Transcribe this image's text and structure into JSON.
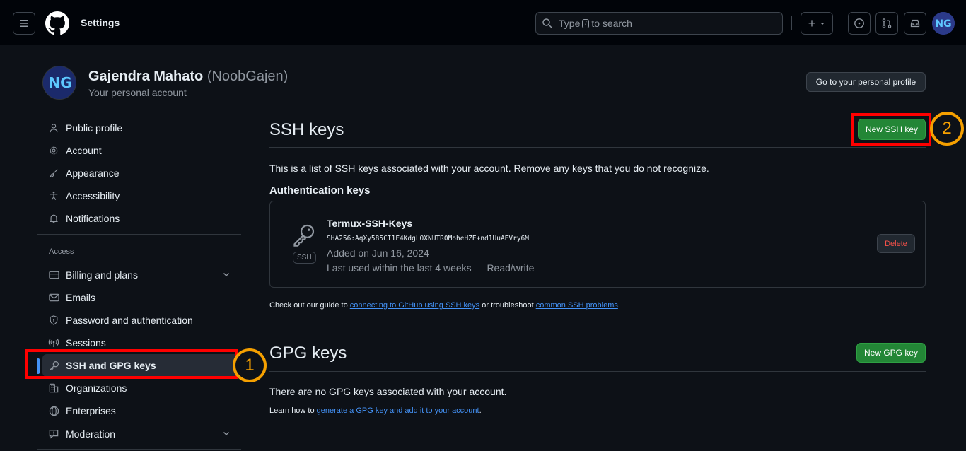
{
  "header": {
    "title": "Settings",
    "search_text_pre": "Type",
    "search_key": "/",
    "search_text_post": "to search",
    "plus_label": "+"
  },
  "profile": {
    "name": "Gajendra Mahato",
    "handle": "(NoobGajen)",
    "subtitle": "Your personal account",
    "avatar_text": "NG",
    "go_profile_button": "Go to your personal profile"
  },
  "sidebar": {
    "items_top": [
      {
        "label": "Public profile",
        "icon": "person-icon"
      },
      {
        "label": "Account",
        "icon": "gear-icon"
      },
      {
        "label": "Appearance",
        "icon": "paintbrush-icon"
      },
      {
        "label": "Accessibility",
        "icon": "accessibility-icon"
      },
      {
        "label": "Notifications",
        "icon": "bell-icon"
      }
    ],
    "access_heading": "Access",
    "items_access": [
      {
        "label": "Billing and plans",
        "icon": "credit-card-icon"
      },
      {
        "label": "Emails",
        "icon": "mail-icon"
      },
      {
        "label": "Password and authentication",
        "icon": "shield-lock-icon"
      },
      {
        "label": "Sessions",
        "icon": "broadcast-icon"
      },
      {
        "label": "SSH and GPG keys",
        "icon": "key-icon"
      },
      {
        "label": "Organizations",
        "icon": "organization-icon"
      },
      {
        "label": "Enterprises",
        "icon": "globe-icon"
      },
      {
        "label": "Moderation",
        "icon": "report-icon"
      }
    ]
  },
  "ssh": {
    "title": "SSH keys",
    "new_button": "New SSH key",
    "description": "This is a list of SSH keys associated with your account. Remove any keys that you do not recognize.",
    "auth_heading": "Authentication keys",
    "key": {
      "name": "Termux-SSH-Keys",
      "fingerprint": "SHA256:AqXy585CI1F4KdgLOXNUTR0MoheHZE+nd1UuAEVry6M",
      "added": "Added on Jun 16, 2024",
      "last_used": "Last used within the last 4 weeks — Read/write",
      "badge": "SSH",
      "delete_button": "Delete"
    },
    "guide_pre": "Check out our guide to",
    "guide_link1": "connecting to GitHub using SSH keys",
    "guide_mid": "or troubleshoot",
    "guide_link2": "common SSH problems",
    "guide_post": "."
  },
  "gpg": {
    "title": "GPG keys",
    "new_button": "New GPG key",
    "empty_text": "There are no GPG keys associated with your account.",
    "learn_pre": "Learn how to",
    "learn_link": "generate a GPG key and add it to your account",
    "learn_post": "."
  },
  "annotations": {
    "step1": "1",
    "step2": "2"
  },
  "colors": {
    "background": "#0d1117",
    "header_bg": "#010409",
    "accent_blue": "#4493f8",
    "button_green": "#238636",
    "annotation_red": "#ff0000",
    "annotation_orange": "#f5a000",
    "danger": "#f85149"
  }
}
